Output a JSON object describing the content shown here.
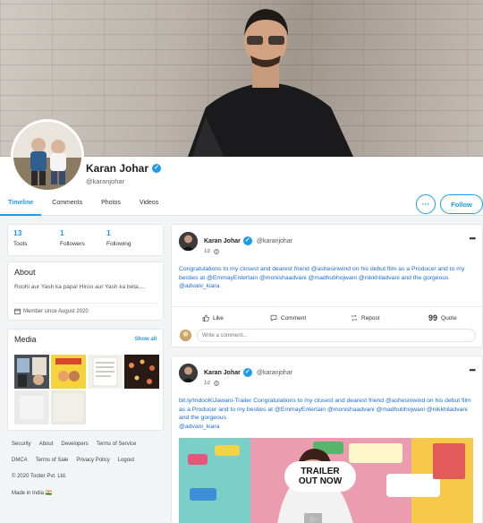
{
  "profile": {
    "name": "Karan Johar",
    "handle": "@karanjohar"
  },
  "tabs": [
    "Timeline",
    "Comments",
    "Photos",
    "Videos"
  ],
  "buttons": {
    "more": "···",
    "follow": "Follow"
  },
  "stats": [
    {
      "value": "13",
      "label": "Toots"
    },
    {
      "value": "1",
      "label": "Followers"
    },
    {
      "value": "1",
      "label": "Following"
    }
  ],
  "about": {
    "title": "About",
    "bio": "Roohi aur Yash ka papa! Hiroo aur Yash ka beta....",
    "member_since": "Member since August 2020"
  },
  "media": {
    "title": "Media",
    "show_all": "Show all"
  },
  "footer": {
    "row1": [
      "Security",
      "About",
      "Developers",
      "Terms of Service"
    ],
    "row2": [
      "DMCA",
      "Terms of Sale",
      "Privacy Policy",
      "Logout"
    ],
    "copyright": "© 2020 Tooter Pvt. Ltd.",
    "made_in": "Made in India 🇮🇳"
  },
  "posts": [
    {
      "author": "Karan Johar",
      "handle": "@karanjohar",
      "time": "1d",
      "text": "Congratulations to my closest and dearest friend @ashesinwind on his debut film as a Producer and to my besties at @EmmayEntertain @monishaadvani @madhubhojwani @nikkhiladvani and the gorgeous",
      "mention": "@advani_kiara",
      "actions": [
        "Like",
        "Comment",
        "Repost",
        "Quote"
      ]
    },
    {
      "author": "Karan Johar",
      "handle": "@karanjohar",
      "time": "1d",
      "link": "bit.ly/IndooKiJawani-Trailer",
      "text": " Congratulations to my closest and dearest friend @ashesinwind on his debut film as a Producer and to my besties at @EmmayEntertain @monishaadvani @madhubhojwani @nikkhiladvani and the gorgeous",
      "mention": "@advani_kiara"
    }
  ],
  "comment_box": {
    "placeholder": "Write a comment..."
  },
  "video": {
    "title_line1": "TRAILER",
    "title_line2": "OUT NOW"
  },
  "colors": {
    "accent": "#1d9bf0",
    "link": "#1d6bd8"
  }
}
